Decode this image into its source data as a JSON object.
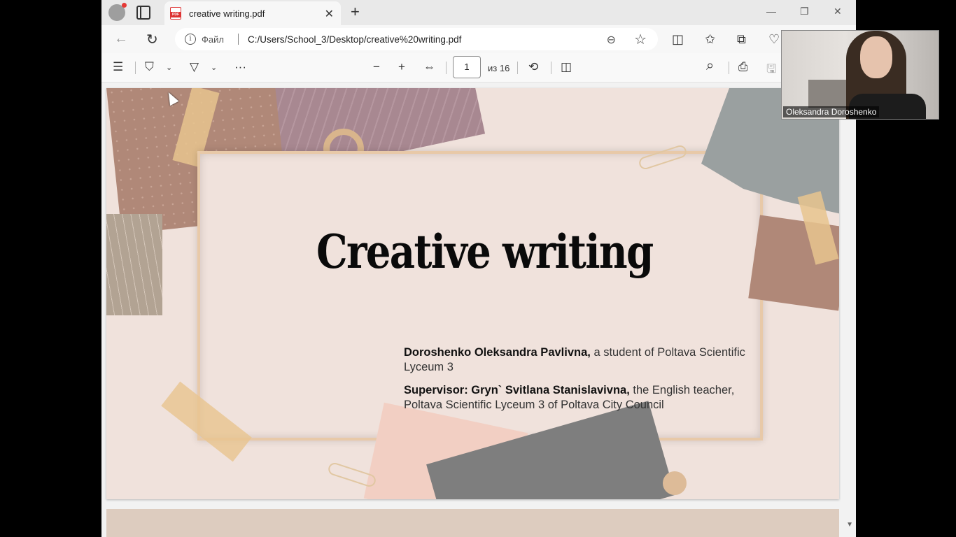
{
  "tab": {
    "title": "creative writing.pdf",
    "close_glyph": "✕",
    "new_glyph": "+"
  },
  "window": {
    "minimize": "—",
    "restore": "❐",
    "close": "✕"
  },
  "address": {
    "back_glyph": "←",
    "reload_glyph": "↻",
    "scheme_label": "Файл",
    "url": "C:/Users/School_3/Desktop/creative%20writing.pdf"
  },
  "toolbar": {
    "contents_glyph": "☰",
    "highlight_glyph": "⛉",
    "draw_glyph": "▽",
    "more_glyph": "···",
    "zoom_out_glyph": "−",
    "zoom_in_glyph": "+",
    "fit_glyph": "⇔",
    "page_current": "1",
    "page_total": "из 16",
    "rotate_glyph": "⟲",
    "layout_glyph": "◫",
    "search_glyph": "⌕",
    "print_glyph": "⎙",
    "save_glyph": "🖫"
  },
  "slide": {
    "title": "Creative writing",
    "author_name": "Doroshenko Oleksandra Pavlivna,",
    "author_desc": " a student of Poltava Scientific Lyceum 3",
    "supervisor_name": "Supervisor: Gryn` Svitlana Stanislavivna,",
    "supervisor_desc": " the English teacher, Poltava Scientific Lyceum 3 of Poltava City Council"
  },
  "video": {
    "participant_name": "Oleksandra Doroshenko"
  },
  "colors": {
    "slide_bg": "#f0e2dc",
    "frame": "#e8c9a8",
    "paper_brown": "#b08878",
    "paper_mauve": "#a88891",
    "paper_grey": "#9aa0a0"
  }
}
